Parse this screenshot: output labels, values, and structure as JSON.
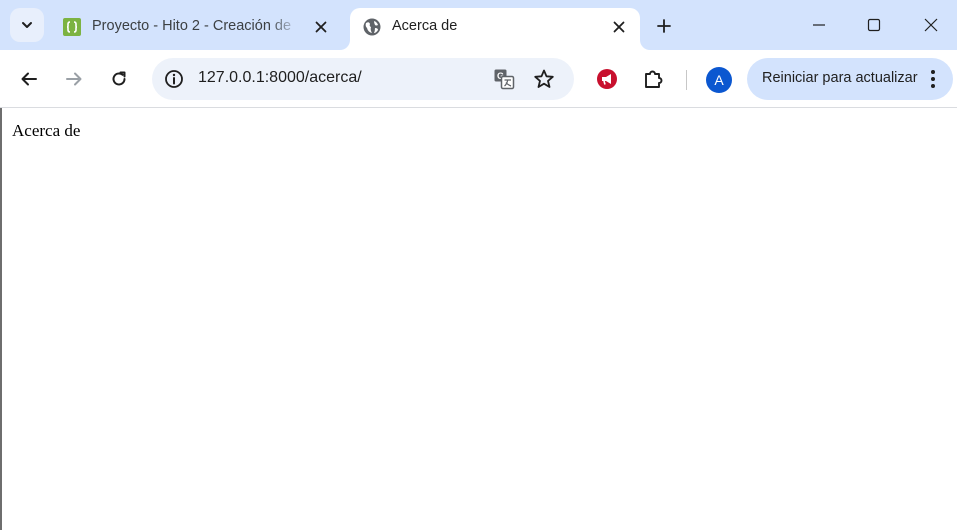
{
  "tabs": [
    {
      "title": "Proyecto - Hito 2 - Creación de",
      "favicon": "code-braces-icon",
      "active": false
    },
    {
      "title": "Acerca de",
      "favicon": "globe-icon",
      "active": true
    }
  ],
  "window_controls": [
    "minimize-icon",
    "maximize-icon",
    "close-icon"
  ],
  "toolbar": {
    "url": "127.0.0.1:8000/acerca/",
    "profile_initial": "A",
    "update_button": "Reiniciar para actualizar"
  },
  "colors": {
    "tabstrip": "#d3e3fd",
    "omnibox": "#edf2fa",
    "avatar": "#0b57d0",
    "extension": "#c8102e"
  },
  "page": {
    "text": "Acerca de"
  }
}
